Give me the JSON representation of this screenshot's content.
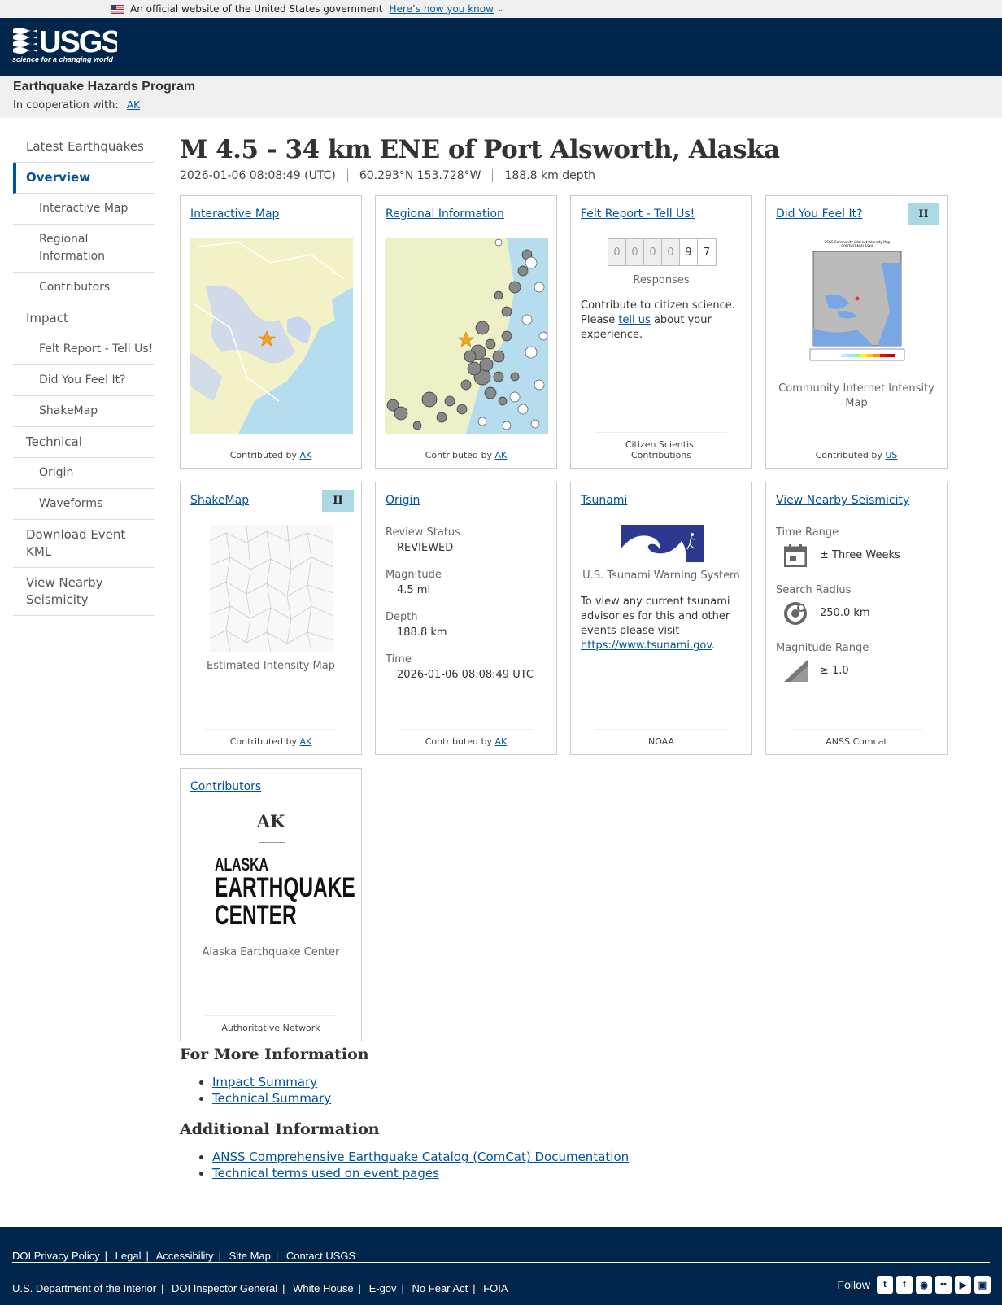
{
  "gov_banner": {
    "text": "An official website of the United States government",
    "link": "Here’s how you know"
  },
  "program": {
    "title": "Earthquake Hazards Program",
    "coop_label": "In cooperation with:",
    "coop_link": "AK"
  },
  "sidebar": {
    "items": [
      {
        "label": "Latest Earthquakes"
      },
      {
        "label": "Overview"
      },
      {
        "label": "Interactive Map"
      },
      {
        "label": "Regional Information"
      },
      {
        "label": "Contributors"
      },
      {
        "label": "Impact"
      },
      {
        "label": "Felt Report - Tell Us!"
      },
      {
        "label": "Did You Feel It?"
      },
      {
        "label": "ShakeMap"
      },
      {
        "label": "Technical"
      },
      {
        "label": "Origin"
      },
      {
        "label": "Waveforms"
      },
      {
        "label": "Download Event KML"
      },
      {
        "label": "View Nearby Seismicity"
      }
    ]
  },
  "event": {
    "title": "M 4.5 - 34 km ENE of Port Alsworth, Alaska",
    "time": "2026-01-06 08:08:49 (UTC)",
    "location": "60.293°N 153.728°W",
    "depth": "188.8 km depth"
  },
  "cards": {
    "interactive_map": {
      "title": "Interactive Map",
      "foot_prefix": "Contributed by",
      "foot_link": "AK"
    },
    "regional": {
      "title": "Regional Information",
      "foot_prefix": "Contributed by",
      "foot_link": "AK"
    },
    "felt": {
      "title": "Felt Report - Tell Us!",
      "digits": [
        "0",
        "0",
        "0",
        "0",
        "9",
        "7"
      ],
      "responses": "Responses",
      "text1": "Contribute to citizen science. Please",
      "link": "tell us",
      "text2": "about your experience.",
      "foot": "Citizen Scientist Contributions"
    },
    "dyfi": {
      "title": "Did You Feel It?",
      "badge": "II",
      "caption": "Community Internet Intensity Map",
      "foot_prefix": "Contributed by",
      "foot_link": "US",
      "map_title": "USGS Community Internet Intensity Map",
      "map_subtitle": "SOUTHERN ALASKA"
    },
    "shakemap": {
      "title": "ShakeMap",
      "badge": "II",
      "caption": "Estimated Intensity Map",
      "foot_prefix": "Contributed by",
      "foot_link": "AK"
    },
    "origin": {
      "title": "Origin",
      "review_label": "Review Status",
      "review": "REVIEWED",
      "mag_label": "Magnitude",
      "mag": "4.5 ml",
      "depth_label": "Depth",
      "depth": "188.8 km",
      "time_label": "Time",
      "time": "2026-01-06 08:08:49 UTC",
      "foot_prefix": "Contributed by",
      "foot_link": "AK"
    },
    "tsunami": {
      "title": "Tsunami",
      "caption": "U.S. Tsunami Warning System",
      "text": "To view any current tsunami advisories for this and other events please visit",
      "link": "https://www.tsunami.gov",
      "period": ".",
      "foot": "NOAA"
    },
    "nearby": {
      "title": "View Nearby Seismicity",
      "time_label": "Time Range",
      "time": "± Three Weeks",
      "radius_label": "Search Radius",
      "radius": "250.0 km",
      "mag_label": "Magnitude Range",
      "mag": "≥ 1.0",
      "foot": "ANSS Comcat"
    },
    "contributors": {
      "title": "Contributors",
      "code": "AK",
      "logo1": "ALASKA",
      "logo2": "EARTHQUAKE",
      "logo3": "CENTER",
      "caption": "Alaska Earthquake Center",
      "foot": "Authoritative Network"
    }
  },
  "more_info": {
    "heading": "For More Information",
    "links": [
      "Impact Summary",
      "Technical Summary"
    ]
  },
  "additional_info": {
    "heading": "Additional Information",
    "links": [
      "ANSS Comprehensive Earthquake Catalog (ComCat) Documentation",
      "Technical terms used on event pages"
    ]
  },
  "footer": {
    "row1": [
      "DOI Privacy Policy",
      "Legal",
      "Accessibility",
      "Site Map",
      "Contact USGS"
    ],
    "row2": [
      "U.S. Department of the Interior",
      "DOI Inspector General",
      "White House",
      "E-gov",
      "No Fear Act",
      "FOIA"
    ],
    "follow": "Follow",
    "social": [
      "twitter-icon",
      "facebook-icon",
      "github-icon",
      "flickr-icon",
      "youtube-icon",
      "instagram-icon"
    ]
  },
  "logo": {
    "text": "USGS",
    "tagline": "science for a changing world"
  }
}
